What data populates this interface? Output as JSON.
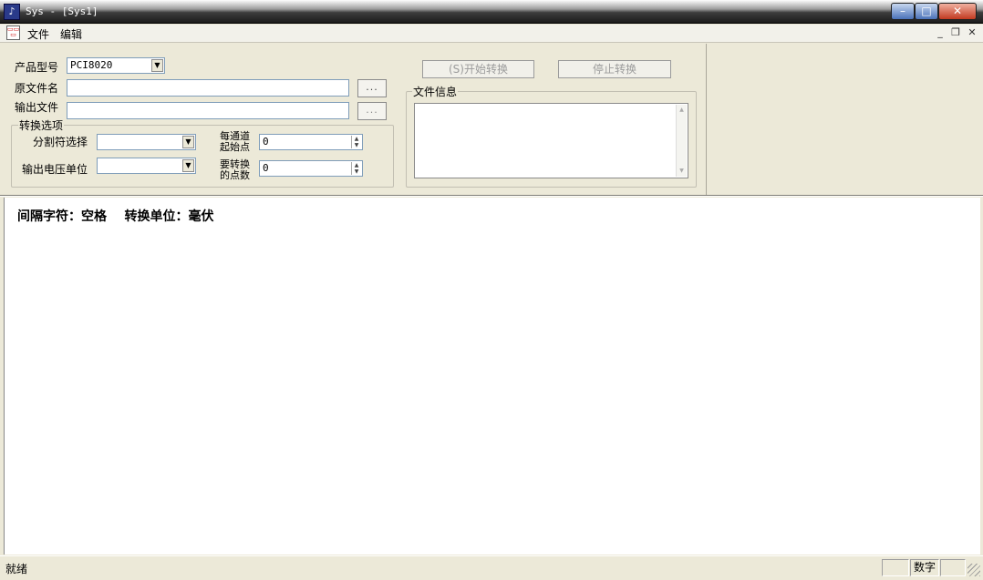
{
  "window": {
    "title": "Sys - [Sys1]",
    "min_glyph": "–",
    "max_glyph": "□",
    "close_glyph": "✕"
  },
  "menubar": {
    "items": [
      {
        "label": "文件"
      },
      {
        "label": "编辑"
      }
    ],
    "mdi_minimize": "_",
    "mdi_restore": "❐",
    "mdi_close": "✕"
  },
  "form": {
    "product_model": {
      "label": "产品型号",
      "value": "PCI8020"
    },
    "source_file": {
      "label": "原文件名",
      "value": "",
      "browse": "..."
    },
    "output_file": {
      "label": "输出文件",
      "value": "",
      "browse": "..."
    },
    "options_group": {
      "title": "转换选项",
      "separator": {
        "label": "分割符选择",
        "value": ""
      },
      "voltage_unit": {
        "label": "输出电压单位",
        "value": ""
      },
      "start_point": {
        "label_line1": "每通道",
        "label_line2": "起始点",
        "value": "0"
      },
      "points": {
        "label_line1": "要转换",
        "label_line2": "的点数",
        "value": "0"
      }
    },
    "start_button": "(S)开始转换",
    "stop_button": "停止转换",
    "file_info": {
      "title": "文件信息",
      "value": ""
    }
  },
  "main": {
    "summary": "间隔字符：空格    转换单位：毫伏"
  },
  "statusbar": {
    "text": "就绪",
    "num_indicator": "数字"
  }
}
